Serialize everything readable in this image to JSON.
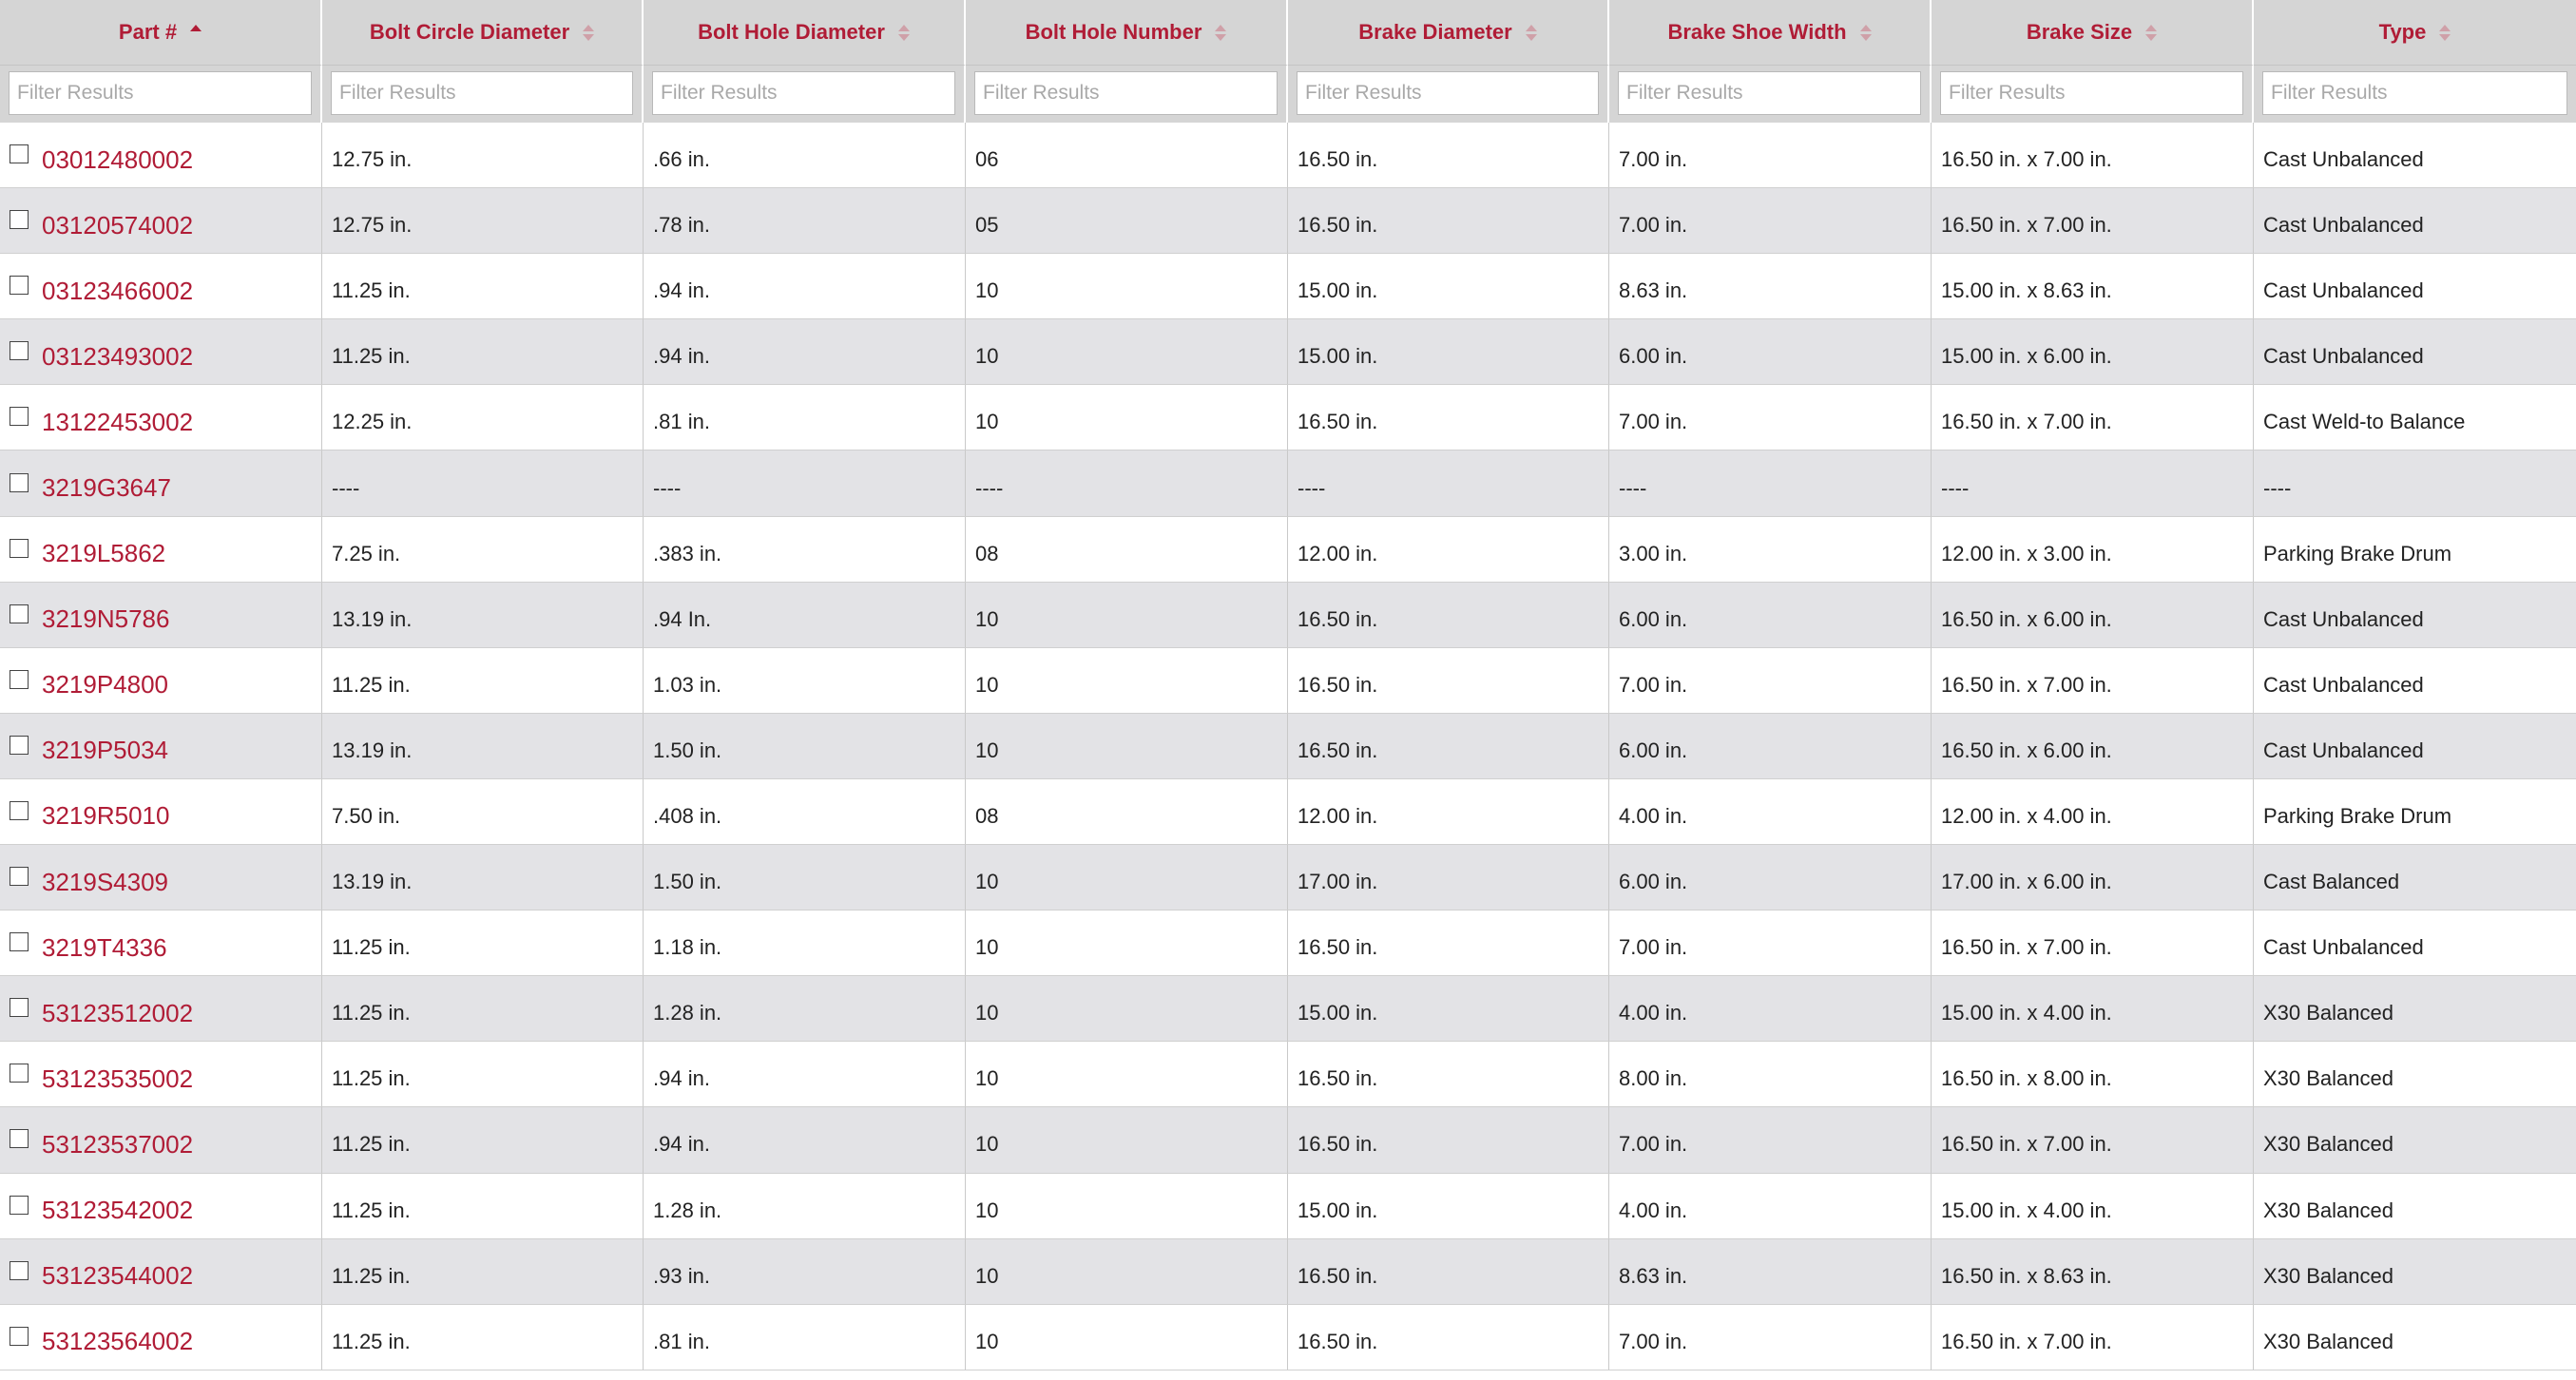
{
  "colors": {
    "accent": "#b01c36",
    "header_bg": "#d5d5d5",
    "row_alt_bg": "#e3e3e6"
  },
  "table": {
    "columns": [
      {
        "label": "Part #",
        "sort": "ascending"
      },
      {
        "label": "Bolt Circle Diameter",
        "sort": "none"
      },
      {
        "label": "Bolt Hole Diameter",
        "sort": "none"
      },
      {
        "label": "Bolt Hole Number",
        "sort": "none"
      },
      {
        "label": "Brake Diameter",
        "sort": "none"
      },
      {
        "label": "Brake Shoe Width",
        "sort": "none"
      },
      {
        "label": "Brake Size",
        "sort": "none"
      },
      {
        "label": "Type",
        "sort": "none"
      }
    ],
    "filter_placeholder": "Filter Results",
    "rows": [
      {
        "part": "03012480002",
        "bolt_circle": "12.75 in.",
        "bolt_hole_dia": ".66 in.",
        "bolt_hole_num": "06",
        "brake_dia": "16.50 in.",
        "shoe_width": "7.00 in.",
        "brake_size": "16.50 in. x 7.00 in.",
        "type": "Cast Unbalanced"
      },
      {
        "part": "03120574002",
        "bolt_circle": "12.75 in.",
        "bolt_hole_dia": ".78 in.",
        "bolt_hole_num": "05",
        "brake_dia": "16.50 in.",
        "shoe_width": "7.00 in.",
        "brake_size": "16.50 in. x 7.00 in.",
        "type": "Cast Unbalanced"
      },
      {
        "part": "03123466002",
        "bolt_circle": "11.25 in.",
        "bolt_hole_dia": ".94 in.",
        "bolt_hole_num": "10",
        "brake_dia": "15.00 in.",
        "shoe_width": "8.63 in.",
        "brake_size": "15.00 in. x 8.63 in.",
        "type": "Cast Unbalanced"
      },
      {
        "part": "03123493002",
        "bolt_circle": "11.25 in.",
        "bolt_hole_dia": ".94 in.",
        "bolt_hole_num": "10",
        "brake_dia": "15.00 in.",
        "shoe_width": "6.00 in.",
        "brake_size": "15.00 in. x 6.00 in.",
        "type": "Cast Unbalanced"
      },
      {
        "part": "13122453002",
        "bolt_circle": "12.25 in.",
        "bolt_hole_dia": ".81 in.",
        "bolt_hole_num": "10",
        "brake_dia": "16.50 in.",
        "shoe_width": "7.00 in.",
        "brake_size": "16.50 in. x 7.00 in.",
        "type": "Cast Weld-to Balance"
      },
      {
        "part": "3219G3647",
        "bolt_circle": "----",
        "bolt_hole_dia": "----",
        "bolt_hole_num": "----",
        "brake_dia": "----",
        "shoe_width": "----",
        "brake_size": "----",
        "type": "----"
      },
      {
        "part": "3219L5862",
        "bolt_circle": "7.25 in.",
        "bolt_hole_dia": ".383 in.",
        "bolt_hole_num": "08",
        "brake_dia": "12.00 in.",
        "shoe_width": "3.00 in.",
        "brake_size": "12.00 in. x 3.00 in.",
        "type": "Parking Brake Drum"
      },
      {
        "part": "3219N5786",
        "bolt_circle": "13.19 in.",
        "bolt_hole_dia": ".94 In.",
        "bolt_hole_num": "10",
        "brake_dia": "16.50 in.",
        "shoe_width": "6.00 in.",
        "brake_size": "16.50 in. x 6.00 in.",
        "type": "Cast Unbalanced"
      },
      {
        "part": "3219P4800",
        "bolt_circle": "11.25 in.",
        "bolt_hole_dia": "1.03 in.",
        "bolt_hole_num": "10",
        "brake_dia": "16.50 in.",
        "shoe_width": "7.00 in.",
        "brake_size": "16.50 in. x 7.00 in.",
        "type": "Cast Unbalanced"
      },
      {
        "part": "3219P5034",
        "bolt_circle": "13.19 in.",
        "bolt_hole_dia": "1.50 in.",
        "bolt_hole_num": "10",
        "brake_dia": "16.50 in.",
        "shoe_width": "6.00 in.",
        "brake_size": "16.50 in. x 6.00 in.",
        "type": "Cast Unbalanced"
      },
      {
        "part": "3219R5010",
        "bolt_circle": "7.50 in.",
        "bolt_hole_dia": ".408 in.",
        "bolt_hole_num": "08",
        "brake_dia": "12.00 in.",
        "shoe_width": "4.00 in.",
        "brake_size": "12.00 in. x 4.00 in.",
        "type": "Parking Brake Drum"
      },
      {
        "part": "3219S4309",
        "bolt_circle": "13.19 in.",
        "bolt_hole_dia": "1.50 in.",
        "bolt_hole_num": "10",
        "brake_dia": "17.00 in.",
        "shoe_width": "6.00 in.",
        "brake_size": "17.00 in. x 6.00 in.",
        "type": "Cast Balanced"
      },
      {
        "part": "3219T4336",
        "bolt_circle": "11.25 in.",
        "bolt_hole_dia": "1.18 in.",
        "bolt_hole_num": "10",
        "brake_dia": "16.50 in.",
        "shoe_width": "7.00 in.",
        "brake_size": "16.50 in. x 7.00 in.",
        "type": "Cast Unbalanced"
      },
      {
        "part": "53123512002",
        "bolt_circle": "11.25 in.",
        "bolt_hole_dia": "1.28 in.",
        "bolt_hole_num": "10",
        "brake_dia": "15.00 in.",
        "shoe_width": "4.00 in.",
        "brake_size": "15.00 in. x 4.00 in.",
        "type": "X30 Balanced"
      },
      {
        "part": "53123535002",
        "bolt_circle": "11.25 in.",
        "bolt_hole_dia": ".94 in.",
        "bolt_hole_num": "10",
        "brake_dia": "16.50 in.",
        "shoe_width": "8.00 in.",
        "brake_size": "16.50 in. x 8.00 in.",
        "type": "X30 Balanced"
      },
      {
        "part": "53123537002",
        "bolt_circle": "11.25 in.",
        "bolt_hole_dia": ".94 in.",
        "bolt_hole_num": "10",
        "brake_dia": "16.50 in.",
        "shoe_width": "7.00 in.",
        "brake_size": "16.50 in. x 7.00 in.",
        "type": "X30 Balanced"
      },
      {
        "part": "53123542002",
        "bolt_circle": "11.25 in.",
        "bolt_hole_dia": "1.28 in.",
        "bolt_hole_num": "10",
        "brake_dia": "15.00 in.",
        "shoe_width": "4.00 in.",
        "brake_size": "15.00 in. x 4.00 in.",
        "type": "X30 Balanced"
      },
      {
        "part": "53123544002",
        "bolt_circle": "11.25 in.",
        "bolt_hole_dia": ".93 in.",
        "bolt_hole_num": "10",
        "brake_dia": "16.50 in.",
        "shoe_width": "8.63 in.",
        "brake_size": "16.50 in. x 8.63 in.",
        "type": "X30 Balanced"
      },
      {
        "part": "53123564002",
        "bolt_circle": "11.25 in.",
        "bolt_hole_dia": ".81 in.",
        "bolt_hole_num": "10",
        "brake_dia": "16.50 in.",
        "shoe_width": "7.00 in.",
        "brake_size": "16.50 in. x 7.00 in.",
        "type": "X30 Balanced"
      }
    ]
  }
}
